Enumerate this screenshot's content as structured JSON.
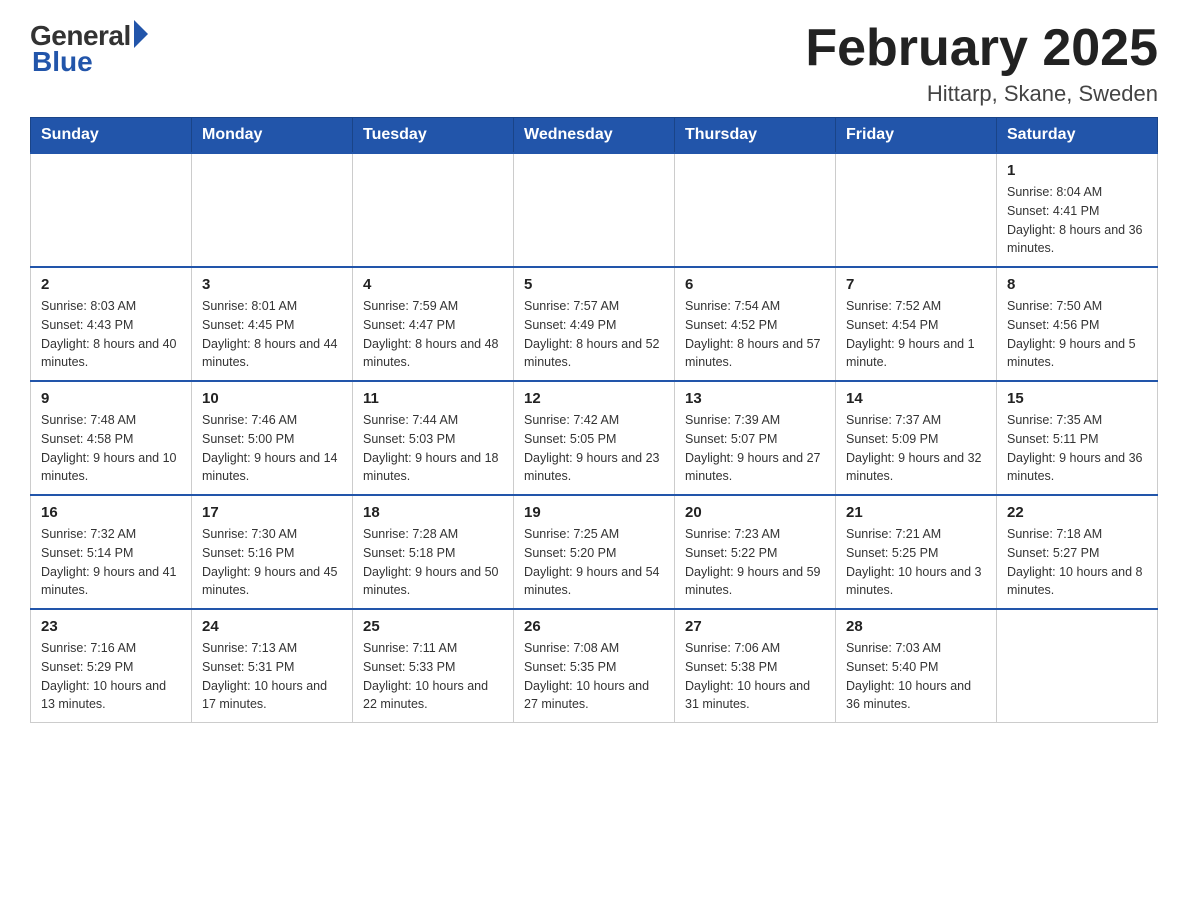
{
  "header": {
    "logo": {
      "general": "General",
      "blue": "Blue"
    },
    "title": "February 2025",
    "location": "Hittarp, Skane, Sweden"
  },
  "weekdays": [
    "Sunday",
    "Monday",
    "Tuesday",
    "Wednesday",
    "Thursday",
    "Friday",
    "Saturday"
  ],
  "weeks": [
    [
      {
        "day": null
      },
      {
        "day": null
      },
      {
        "day": null
      },
      {
        "day": null
      },
      {
        "day": null
      },
      {
        "day": null
      },
      {
        "day": "1",
        "sunrise": "Sunrise: 8:04 AM",
        "sunset": "Sunset: 4:41 PM",
        "daylight": "Daylight: 8 hours and 36 minutes."
      }
    ],
    [
      {
        "day": "2",
        "sunrise": "Sunrise: 8:03 AM",
        "sunset": "Sunset: 4:43 PM",
        "daylight": "Daylight: 8 hours and 40 minutes."
      },
      {
        "day": "3",
        "sunrise": "Sunrise: 8:01 AM",
        "sunset": "Sunset: 4:45 PM",
        "daylight": "Daylight: 8 hours and 44 minutes."
      },
      {
        "day": "4",
        "sunrise": "Sunrise: 7:59 AM",
        "sunset": "Sunset: 4:47 PM",
        "daylight": "Daylight: 8 hours and 48 minutes."
      },
      {
        "day": "5",
        "sunrise": "Sunrise: 7:57 AM",
        "sunset": "Sunset: 4:49 PM",
        "daylight": "Daylight: 8 hours and 52 minutes."
      },
      {
        "day": "6",
        "sunrise": "Sunrise: 7:54 AM",
        "sunset": "Sunset: 4:52 PM",
        "daylight": "Daylight: 8 hours and 57 minutes."
      },
      {
        "day": "7",
        "sunrise": "Sunrise: 7:52 AM",
        "sunset": "Sunset: 4:54 PM",
        "daylight": "Daylight: 9 hours and 1 minute."
      },
      {
        "day": "8",
        "sunrise": "Sunrise: 7:50 AM",
        "sunset": "Sunset: 4:56 PM",
        "daylight": "Daylight: 9 hours and 5 minutes."
      }
    ],
    [
      {
        "day": "9",
        "sunrise": "Sunrise: 7:48 AM",
        "sunset": "Sunset: 4:58 PM",
        "daylight": "Daylight: 9 hours and 10 minutes."
      },
      {
        "day": "10",
        "sunrise": "Sunrise: 7:46 AM",
        "sunset": "Sunset: 5:00 PM",
        "daylight": "Daylight: 9 hours and 14 minutes."
      },
      {
        "day": "11",
        "sunrise": "Sunrise: 7:44 AM",
        "sunset": "Sunset: 5:03 PM",
        "daylight": "Daylight: 9 hours and 18 minutes."
      },
      {
        "day": "12",
        "sunrise": "Sunrise: 7:42 AM",
        "sunset": "Sunset: 5:05 PM",
        "daylight": "Daylight: 9 hours and 23 minutes."
      },
      {
        "day": "13",
        "sunrise": "Sunrise: 7:39 AM",
        "sunset": "Sunset: 5:07 PM",
        "daylight": "Daylight: 9 hours and 27 minutes."
      },
      {
        "day": "14",
        "sunrise": "Sunrise: 7:37 AM",
        "sunset": "Sunset: 5:09 PM",
        "daylight": "Daylight: 9 hours and 32 minutes."
      },
      {
        "day": "15",
        "sunrise": "Sunrise: 7:35 AM",
        "sunset": "Sunset: 5:11 PM",
        "daylight": "Daylight: 9 hours and 36 minutes."
      }
    ],
    [
      {
        "day": "16",
        "sunrise": "Sunrise: 7:32 AM",
        "sunset": "Sunset: 5:14 PM",
        "daylight": "Daylight: 9 hours and 41 minutes."
      },
      {
        "day": "17",
        "sunrise": "Sunrise: 7:30 AM",
        "sunset": "Sunset: 5:16 PM",
        "daylight": "Daylight: 9 hours and 45 minutes."
      },
      {
        "day": "18",
        "sunrise": "Sunrise: 7:28 AM",
        "sunset": "Sunset: 5:18 PM",
        "daylight": "Daylight: 9 hours and 50 minutes."
      },
      {
        "day": "19",
        "sunrise": "Sunrise: 7:25 AM",
        "sunset": "Sunset: 5:20 PM",
        "daylight": "Daylight: 9 hours and 54 minutes."
      },
      {
        "day": "20",
        "sunrise": "Sunrise: 7:23 AM",
        "sunset": "Sunset: 5:22 PM",
        "daylight": "Daylight: 9 hours and 59 minutes."
      },
      {
        "day": "21",
        "sunrise": "Sunrise: 7:21 AM",
        "sunset": "Sunset: 5:25 PM",
        "daylight": "Daylight: 10 hours and 3 minutes."
      },
      {
        "day": "22",
        "sunrise": "Sunrise: 7:18 AM",
        "sunset": "Sunset: 5:27 PM",
        "daylight": "Daylight: 10 hours and 8 minutes."
      }
    ],
    [
      {
        "day": "23",
        "sunrise": "Sunrise: 7:16 AM",
        "sunset": "Sunset: 5:29 PM",
        "daylight": "Daylight: 10 hours and 13 minutes."
      },
      {
        "day": "24",
        "sunrise": "Sunrise: 7:13 AM",
        "sunset": "Sunset: 5:31 PM",
        "daylight": "Daylight: 10 hours and 17 minutes."
      },
      {
        "day": "25",
        "sunrise": "Sunrise: 7:11 AM",
        "sunset": "Sunset: 5:33 PM",
        "daylight": "Daylight: 10 hours and 22 minutes."
      },
      {
        "day": "26",
        "sunrise": "Sunrise: 7:08 AM",
        "sunset": "Sunset: 5:35 PM",
        "daylight": "Daylight: 10 hours and 27 minutes."
      },
      {
        "day": "27",
        "sunrise": "Sunrise: 7:06 AM",
        "sunset": "Sunset: 5:38 PM",
        "daylight": "Daylight: 10 hours and 31 minutes."
      },
      {
        "day": "28",
        "sunrise": "Sunrise: 7:03 AM",
        "sunset": "Sunset: 5:40 PM",
        "daylight": "Daylight: 10 hours and 36 minutes."
      },
      {
        "day": null
      }
    ]
  ]
}
